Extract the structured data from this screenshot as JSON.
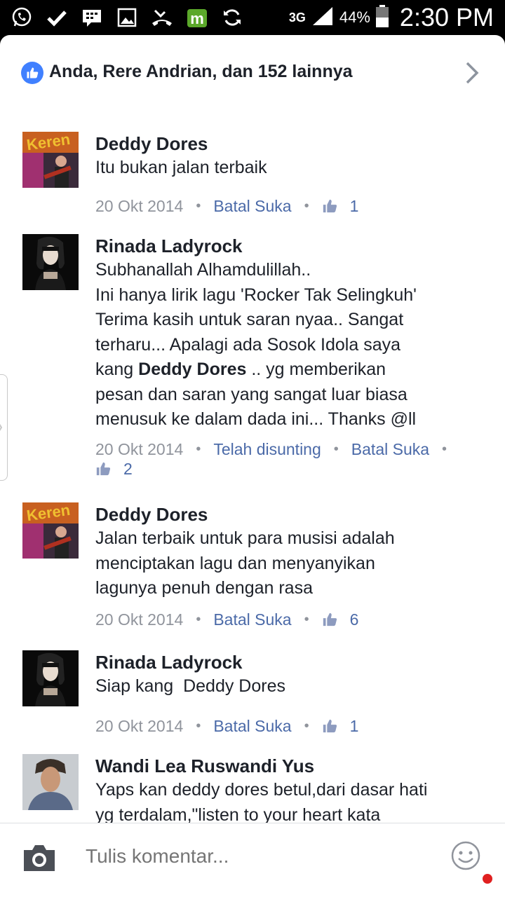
{
  "status_bar": {
    "network": "3G",
    "battery": "44%",
    "time": "2:30 PM",
    "icons": [
      "whatsapp-icon",
      "check-icon",
      "bbm-icon",
      "image-icon",
      "missed-call-icon",
      "mobile-app-icon",
      "sync-icon"
    ]
  },
  "likes_summary": {
    "text": "Anda, Rere Andrian, dan 152 lainnya"
  },
  "comments": [
    {
      "author": "Deddy Dores",
      "text": "Itu bukan jalan terbaik",
      "date": "20 Okt 2014",
      "unlike": "Batal Suka",
      "likes": "1"
    },
    {
      "author": "Rinada Ladyrock",
      "text_before": "Subhanallah Alhamdulillah..\nIni hanya lirik lagu 'Rocker Tak Selingkuh'\nTerima kasih untuk saran nyaa.. Sangat\nterharu... Apalagi ada Sosok Idola saya\nkang ",
      "mention": "Deddy Dores",
      "text_after": " .. yg memberikan\npesan dan saran yang sangat luar biasa\nmenusuk ke dalam dada ini... Thanks @ll",
      "date": "20 Okt 2014",
      "edited": "Telah disunting",
      "unlike": "Batal Suka",
      "likes": "2"
    },
    {
      "author": "Deddy Dores",
      "text": "Jalan terbaik untuk para musisi adalah\nmenciptakan lagu dan menyanyikan\nlagunya penuh dengan rasa",
      "date": "20 Okt 2014",
      "unlike": "Batal Suka",
      "likes": "6"
    },
    {
      "author": "Rinada Ladyrock",
      "text": "Siap kang  Deddy Dores",
      "date": "20 Okt 2014",
      "unlike": "Batal Suka",
      "likes": "1"
    },
    {
      "author": "Wandi Lea Ruswandi Yus",
      "text": "Yaps kan deddy dores betul,dari dasar hati\nyg terdalam,\"listen to your heart kata"
    }
  ],
  "composer": {
    "placeholder": "Tulis komentar..."
  },
  "colors": {
    "accent": "#4b6aa8",
    "like_badge": "#4080ff",
    "text": "#1d2129",
    "muted": "#90949c"
  }
}
